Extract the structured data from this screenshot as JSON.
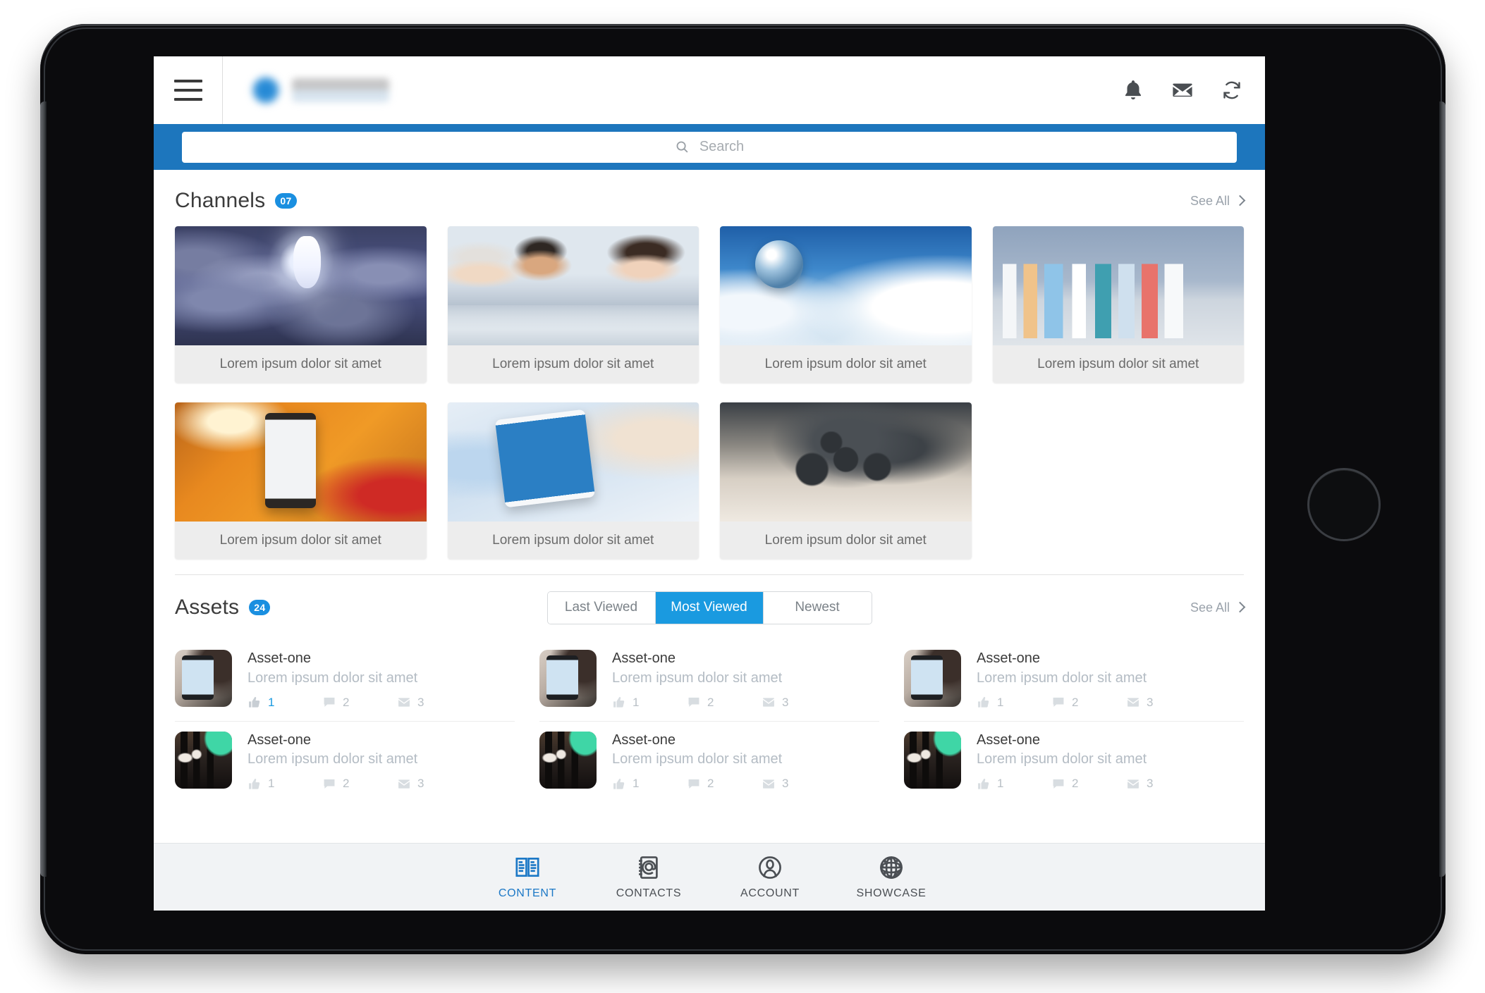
{
  "header": {
    "menu_icon": "hamburger-icon",
    "logo_alt": "blurred-company-logo",
    "actions": [
      {
        "name": "notifications",
        "icon": "bell-icon"
      },
      {
        "name": "messages",
        "icon": "envelope-icon"
      },
      {
        "name": "refresh",
        "icon": "refresh-icon"
      }
    ]
  },
  "search": {
    "placeholder": "Search",
    "value": "",
    "icon": "search-icon",
    "bar_color": "#1d76bd"
  },
  "channels": {
    "title": "Channels",
    "count_badge": "07",
    "see_all": "See All",
    "items": [
      {
        "caption": "Lorem ipsum dolor sit amet",
        "image": "lightbulbs"
      },
      {
        "caption": "Lorem ipsum dolor sit amet",
        "image": "business-meeting"
      },
      {
        "caption": "Lorem ipsum dolor sit amet",
        "image": "glass-globe-cubes"
      },
      {
        "caption": "Lorem ipsum dolor sit amet",
        "image": "paper-city-buildings"
      },
      {
        "caption": "Lorem ipsum dolor sit amet",
        "image": "smartphone-in-hand"
      },
      {
        "caption": "Lorem ipsum dolor sit amet",
        "image": "tablet-charts"
      },
      {
        "caption": "Lorem ipsum dolor sit amet",
        "image": "gears-figurines"
      }
    ]
  },
  "assets": {
    "title": "Assets",
    "count_badge": "24",
    "see_all": "See All",
    "tabs": [
      {
        "label": "Last Viewed",
        "active": false
      },
      {
        "label": "Most Viewed",
        "active": true
      },
      {
        "label": "Newest",
        "active": false
      }
    ],
    "active_tab_color": "#1a9ae0",
    "stat_icons": [
      "thumbs-up-icon",
      "comment-icon",
      "envelope-icon"
    ],
    "items": [
      {
        "title": "Asset-one",
        "subtitle": "Lorem ipsum dolor sit amet",
        "thumb": "ipad-person",
        "likes": "1",
        "comments": "2",
        "messages": "3",
        "likes_highlighted": true
      },
      {
        "title": "Asset-one",
        "subtitle": "Lorem ipsum dolor sit amet",
        "thumb": "ipad-person",
        "likes": "1",
        "comments": "2",
        "messages": "3",
        "likes_highlighted": false
      },
      {
        "title": "Asset-one",
        "subtitle": "Lorem ipsum dolor sit amet",
        "thumb": "ipad-person",
        "likes": "1",
        "comments": "2",
        "messages": "3",
        "likes_highlighted": false
      },
      {
        "title": "Asset-one",
        "subtitle": "Lorem ipsum dolor sit amet",
        "thumb": "chess-dark",
        "likes": "1",
        "comments": "2",
        "messages": "3",
        "likes_highlighted": false
      },
      {
        "title": "Asset-one",
        "subtitle": "Lorem ipsum dolor sit amet",
        "thumb": "chess-dark",
        "likes": "1",
        "comments": "2",
        "messages": "3",
        "likes_highlighted": false
      },
      {
        "title": "Asset-one",
        "subtitle": "Lorem ipsum dolor sit amet",
        "thumb": "chess-dark",
        "likes": "1",
        "comments": "2",
        "messages": "3",
        "likes_highlighted": false
      }
    ]
  },
  "tabbar": {
    "active_color": "#1c78c6",
    "items": [
      {
        "label": "CONTENT",
        "icon": "content-pages-icon",
        "active": true
      },
      {
        "label": "CONTACTS",
        "icon": "address-book-icon",
        "active": false
      },
      {
        "label": "ACCOUNT",
        "icon": "person-icon",
        "active": false
      },
      {
        "label": "SHOWCASE",
        "icon": "sphere-icon",
        "active": false
      }
    ]
  }
}
